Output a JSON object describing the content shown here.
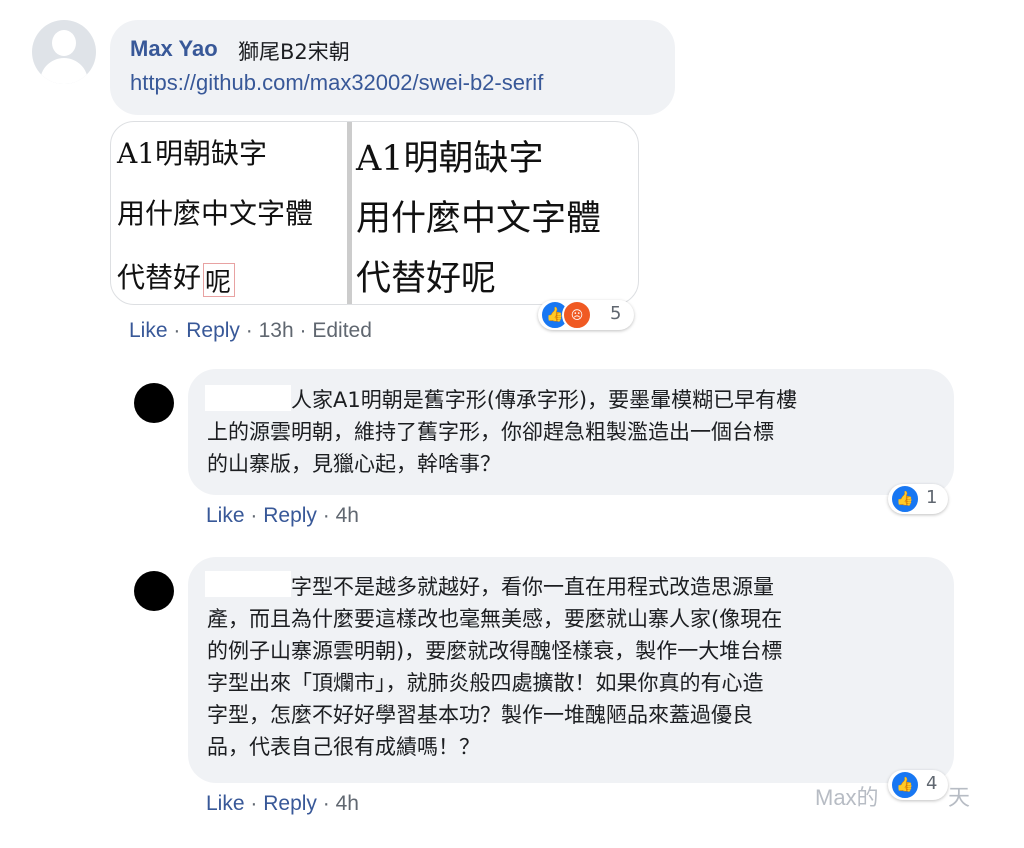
{
  "comment": {
    "author": "Max Yao",
    "author_suffix": "獅尾B2宋朝",
    "link": "https://github.com/max32002/swei-b2-serif",
    "image": {
      "left_lines": [
        "A1明朝缺字",
        "用什麼中文字體",
        "代替好"
      ],
      "left_last_glyph": "呢",
      "right_lines": [
        "A1明朝缺字",
        "用什麼中文字體",
        "代替好呢"
      ]
    },
    "reactions": {
      "count": "5",
      "icons": [
        "like-icon",
        "angry-icon"
      ]
    },
    "actions": {
      "like": "Like",
      "reply": "Reply",
      "time": "13h",
      "edited": "Edited"
    }
  },
  "replies": [
    {
      "lines": [
        "人家A1明朝是舊字形(傳承字形)，要墨暈模糊已早有樓",
        "上的源雲明朝，維持了舊字形，你卻趕急粗製濫造出一個台標",
        "的山寨版，見獵心起，幹啥事？"
      ],
      "reactions": {
        "count": "1",
        "icons": [
          "like-icon"
        ]
      },
      "actions": {
        "like": "Like",
        "reply": "Reply",
        "time": "4h"
      }
    },
    {
      "lines": [
        "字型不是越多就越好，看你一直在用程式改造思源量",
        "產，而且為什麼要這樣改也毫無美感，要麼就山寨人家(像現在",
        "的例子山寨源雲明朝)，要麼就改得醜怪樣衰，製作一大堆台標",
        "字型出來「頂爛市」，就肺炎般四處擴散！如果你真的有心造",
        "字型，怎麼不好好學習基本功？製作一堆醜陋品來蓋過優良",
        "品，代表自己很有成績嗎！？"
      ],
      "reactions": {
        "count": "4",
        "icons": [
          "like-icon"
        ]
      },
      "actions": {
        "like": "Like",
        "reply": "Reply",
        "time": "4h"
      }
    }
  ],
  "separator": "·",
  "watermark": "Max的",
  "watermark_tail": "天",
  "colors": {
    "link": "#385898",
    "bubble": "#f0f2f5",
    "meta": "#606770",
    "like": "#1877f2"
  }
}
